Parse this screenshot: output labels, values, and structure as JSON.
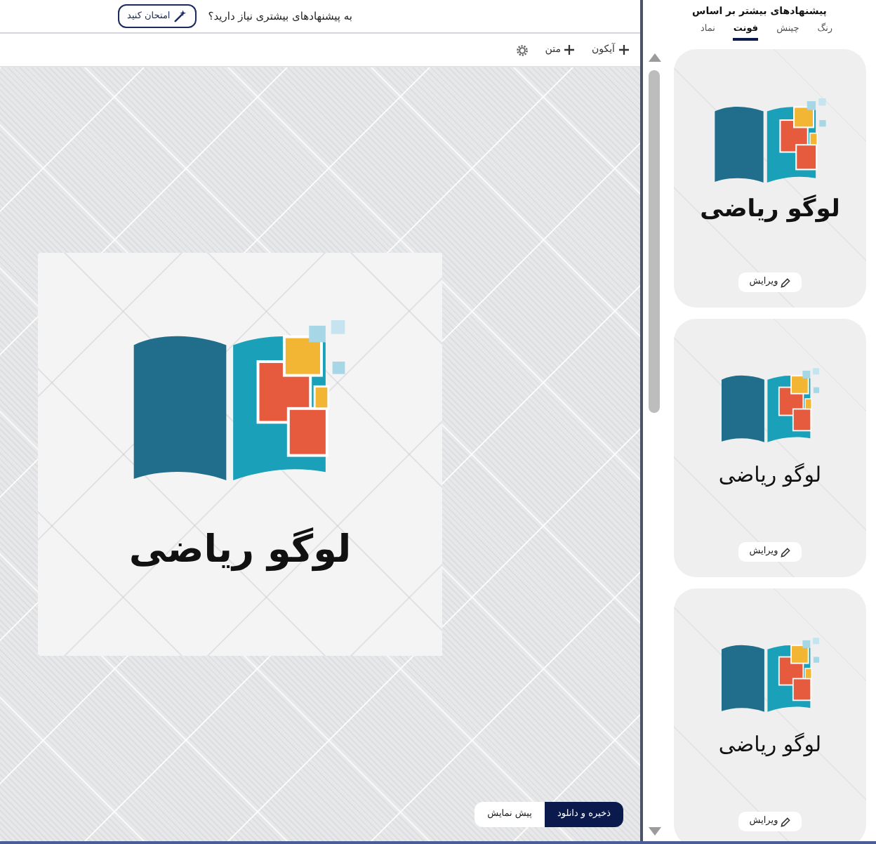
{
  "top_bar": {
    "prompt": "به پیشنهادهای بیشتری نیاز دارید؟",
    "try_button": "امتحان کنید"
  },
  "toolbar": {
    "add_buttons": [
      "آیکون",
      "متن"
    ]
  },
  "canvas": {
    "logo_text": "لوگو ریاضی"
  },
  "actions": [
    {
      "label": "ذخیره و دانلود",
      "primary": true
    },
    {
      "label": "پیش نمایش",
      "primary": false
    }
  ],
  "suggestions": {
    "title": "پیشنهادهای بیشتر بر اساس",
    "tabs": [
      {
        "label": "رنگ",
        "selected": false
      },
      {
        "label": "چینش",
        "selected": false
      },
      {
        "label": "فونت",
        "selected": true
      },
      {
        "label": "نماد",
        "selected": false
      }
    ],
    "cards": [
      {
        "kind": "block",
        "logo_text": "لوگو ریاضی",
        "edit_button": "ویرایش"
      },
      {
        "kind": "plain",
        "logo_text": "لوگو ریاضی",
        "edit_button": "ویرایش"
      },
      {
        "kind": "plain",
        "logo_text": "لوگو ریاضی",
        "edit_button": "ویرایش"
      }
    ]
  }
}
